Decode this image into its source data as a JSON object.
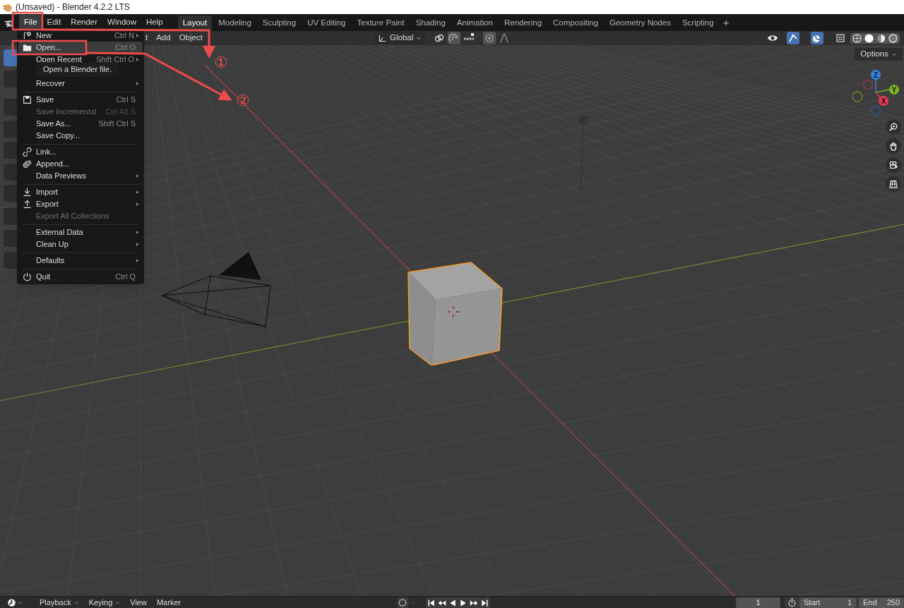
{
  "window": {
    "title": "(Unsaved) - Blender 4.2.2 LTS"
  },
  "menubar": [
    {
      "label": "File",
      "selected": true
    },
    {
      "label": "Edit",
      "selected": false
    },
    {
      "label": "Render",
      "selected": false
    },
    {
      "label": "Window",
      "selected": false
    },
    {
      "label": "Help",
      "selected": false
    }
  ],
  "workspaces": [
    {
      "label": "Layout",
      "selected": true
    },
    {
      "label": "Modeling",
      "selected": false
    },
    {
      "label": "Sculpting",
      "selected": false
    },
    {
      "label": "UV Editing",
      "selected": false
    },
    {
      "label": "Texture Paint",
      "selected": false
    },
    {
      "label": "Shading",
      "selected": false
    },
    {
      "label": "Animation",
      "selected": false
    },
    {
      "label": "Rendering",
      "selected": false
    },
    {
      "label": "Compositing",
      "selected": false
    },
    {
      "label": "Geometry Nodes",
      "selected": false
    },
    {
      "label": "Scripting",
      "selected": false
    }
  ],
  "add_workspace": "+",
  "viewport_header": {
    "menus": [
      "t",
      "Add",
      "Object"
    ],
    "orientation": "Global",
    "options": "Options"
  },
  "file_menu": [
    {
      "kind": "item",
      "label": "New",
      "shortcut": "Ctrl N",
      "submenu": true,
      "disabled": false,
      "highlighted": false
    },
    {
      "kind": "item",
      "label": "Open...",
      "shortcut": "Ctrl O",
      "submenu": false,
      "disabled": false,
      "highlighted": true
    },
    {
      "kind": "item",
      "label": "Open Recent",
      "shortcut": "Shift Ctrl O",
      "submenu": true,
      "disabled": false,
      "highlighted": false
    },
    {
      "kind": "tooltip",
      "label": "Open a Blender file."
    },
    {
      "kind": "item",
      "label": "Recover",
      "submenu": true,
      "disabled": false,
      "highlighted": false
    },
    {
      "kind": "separator"
    },
    {
      "kind": "item",
      "label": "Save",
      "shortcut": "Ctrl S",
      "submenu": false,
      "disabled": false,
      "highlighted": false
    },
    {
      "kind": "item",
      "label": "Save Incremental",
      "shortcut": "Ctrl Alt S",
      "submenu": false,
      "disabled": true,
      "highlighted": false
    },
    {
      "kind": "item",
      "label": "Save As...",
      "shortcut": "Shift Ctrl S",
      "submenu": false,
      "disabled": false,
      "highlighted": false
    },
    {
      "kind": "item",
      "label": "Save Copy...",
      "submenu": false,
      "disabled": false,
      "highlighted": false
    },
    {
      "kind": "separator"
    },
    {
      "kind": "item",
      "label": "Link...",
      "submenu": false,
      "disabled": false,
      "highlighted": false
    },
    {
      "kind": "item",
      "label": "Append...",
      "submenu": false,
      "disabled": false,
      "highlighted": false
    },
    {
      "kind": "item",
      "label": "Data Previews",
      "submenu": true,
      "disabled": false,
      "highlighted": false
    },
    {
      "kind": "separator"
    },
    {
      "kind": "item",
      "label": "Import",
      "submenu": true,
      "disabled": false,
      "highlighted": false
    },
    {
      "kind": "item",
      "label": "Export",
      "submenu": true,
      "disabled": false,
      "highlighted": false
    },
    {
      "kind": "item",
      "label": "Export All Collections",
      "submenu": false,
      "disabled": true,
      "highlighted": false
    },
    {
      "kind": "separator"
    },
    {
      "kind": "item",
      "label": "External Data",
      "submenu": true,
      "disabled": false,
      "highlighted": false
    },
    {
      "kind": "item",
      "label": "Clean Up",
      "submenu": true,
      "disabled": false,
      "highlighted": false
    },
    {
      "kind": "separator"
    },
    {
      "kind": "item",
      "label": "Defaults",
      "submenu": true,
      "disabled": false,
      "highlighted": false
    },
    {
      "kind": "separator"
    },
    {
      "kind": "item",
      "label": "Quit",
      "shortcut": "Ctrl Q",
      "submenu": false,
      "disabled": false,
      "highlighted": false
    }
  ],
  "gizmo_axes": [
    "Z",
    "Y",
    "X"
  ],
  "annotations": [
    {
      "label": "①"
    },
    {
      "label": "②"
    }
  ],
  "timeline": {
    "menus": [
      "Playback",
      "Keying",
      "View",
      "Marker"
    ],
    "current_frame": "1",
    "start_label": "Start",
    "start": "1",
    "end_label": "End",
    "end": "250"
  }
}
